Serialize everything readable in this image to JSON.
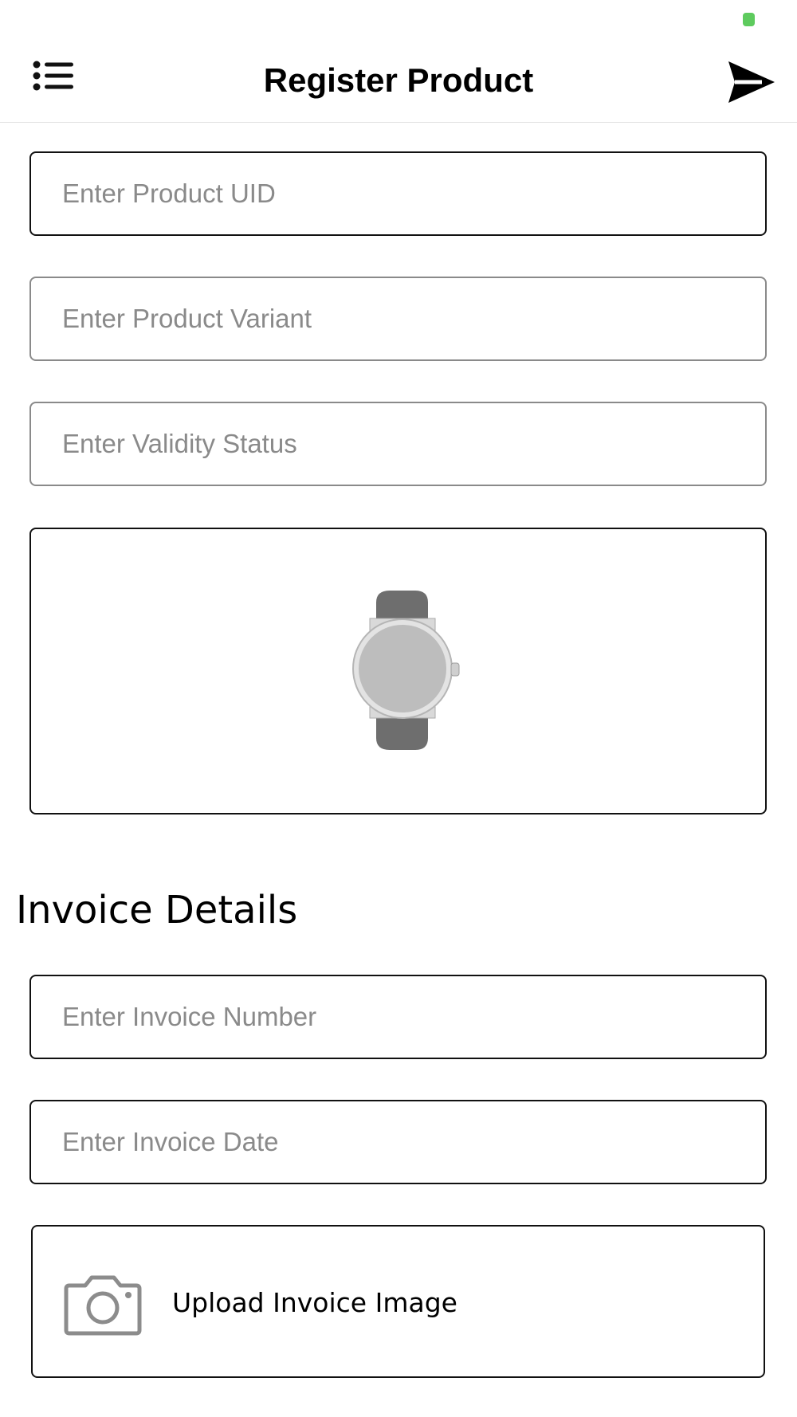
{
  "header": {
    "title": "Register Product",
    "menu_icon": "list-menu-icon",
    "send_icon": "send-icon"
  },
  "product_form": {
    "uid_placeholder": "Enter Product UID",
    "variant_placeholder": "Enter Product Variant",
    "validity_placeholder": "Enter Validity Status",
    "image_icon": "wristwatch-image"
  },
  "invoice": {
    "section_title": "Invoice Details",
    "number_placeholder": "Enter Invoice Number",
    "date_placeholder": "Enter Invoice Date",
    "upload_label": "Upload Invoice Image",
    "upload_icon": "camera-icon"
  },
  "colors": {
    "battery": "#5ecb5e",
    "placeholder": "#8a8a8a",
    "border": "#111111"
  }
}
